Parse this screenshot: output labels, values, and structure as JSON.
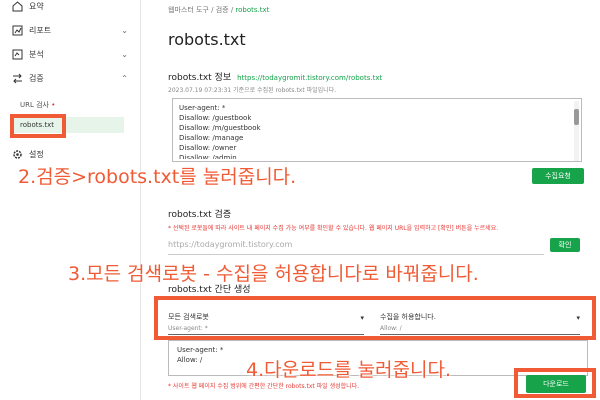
{
  "colors": {
    "accent": "#16a34a",
    "annotation": "#f05a34",
    "warning": "#e53935"
  },
  "sidebar": {
    "items": [
      {
        "label": "요약",
        "icon": "home-icon"
      },
      {
        "label": "리포트",
        "icon": "chart-icon"
      },
      {
        "label": "분석",
        "icon": "analytics-icon"
      },
      {
        "label": "검증",
        "icon": "swap-icon"
      }
    ],
    "sub_items": [
      {
        "label": "URL 검사"
      },
      {
        "label": "robots.txt"
      }
    ],
    "settings_label": "설정"
  },
  "breadcrumb": {
    "a": "웹마스터 도구",
    "sep": "/",
    "b": "검증",
    "current": "robots.txt"
  },
  "page_title": "robots.txt",
  "info": {
    "title": "robots.txt 정보",
    "url": "https://todaygromit.tistory.com/robots.txt",
    "note": "2023.07.19 07:23:31 기준으로 수집된 robots.txt 파일입니다.",
    "lines": [
      "User-agent: *",
      "Disallow: /guestbook",
      "Disallow: /m/guestbook",
      "Disallow: /manage",
      "Disallow: /owner",
      "Disallow: /admin"
    ],
    "collect_button": "수집요청"
  },
  "verify": {
    "title": "robots.txt 검증",
    "note": "* 선택된 로봇들에 따라 사이트 내 페이지 수집 가능 여부를 확인할 수 있습니다. 웹 페이지 URL을 입력하고 [확인] 버튼을 누르세요.",
    "placeholder": "https://todaygromit.tistory.com",
    "confirm_button": "확인"
  },
  "simple": {
    "title": "robots.txt 간단 생성",
    "robot_select": "모든 검색로봇",
    "robot_caption": "User-agent: *",
    "rule_select": "수집을 허용합니다.",
    "rule_caption": "Allow: /",
    "output_lines": [
      "User-agent: *",
      "Allow: /"
    ],
    "note": "* 사이트 웹 페이지 수집 범위에 간편한 간단한 robots.txt 파일 생성합니다.",
    "download_button": "다운로드"
  },
  "annotations": {
    "step2": "2.검증>robots.txt를 눌러줍니다.",
    "step3": "3.모든 검색로봇 - 수집을 허용합니다로 바꿔줍니다.",
    "step4": "4.다운로드를 눌러줍니다."
  }
}
